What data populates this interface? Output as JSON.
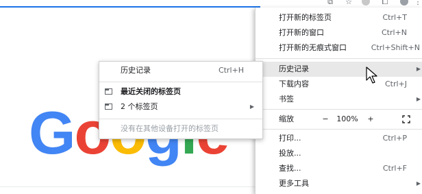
{
  "logo": {
    "letters": [
      "G",
      "o",
      "o",
      "g",
      "l",
      "e"
    ],
    "colors": [
      "#4285f4",
      "#ea4335",
      "#fbbc05",
      "#4285f4",
      "#34a853",
      "#ea4335"
    ]
  },
  "menu": {
    "new_tab": {
      "label": "打开新的标签页",
      "shortcut": "Ctrl+T"
    },
    "new_window": {
      "label": "打开新的窗口",
      "shortcut": "Ctrl+N"
    },
    "new_incognito": {
      "label": "打开新的无痕式窗口",
      "shortcut": "Ctrl+Shift+N"
    },
    "history": {
      "label": "历史记录"
    },
    "downloads": {
      "label": "下载内容",
      "shortcut": "Ctrl+J"
    },
    "bookmarks": {
      "label": "书签"
    },
    "zoom": {
      "label": "缩放",
      "minus": "−",
      "value": "100%",
      "plus": "+"
    },
    "print": {
      "label": "打印...",
      "shortcut": "Ctrl+P"
    },
    "cast": {
      "label": "投放..."
    },
    "find": {
      "label": "查找...",
      "shortcut": "Ctrl+F"
    },
    "more_tools": {
      "label": "更多工具"
    }
  },
  "history_submenu": {
    "history": {
      "label": "历史记录",
      "shortcut": "Ctrl+H"
    },
    "recently_closed": {
      "label": "最近关闭的标签页"
    },
    "tabs": {
      "label": "2 个标签页"
    },
    "no_other_devices": {
      "label": "没有在其他设备打开的标签页"
    }
  },
  "colors": {
    "accent": "#1a73e8",
    "highlight": "#e8e8e8"
  }
}
